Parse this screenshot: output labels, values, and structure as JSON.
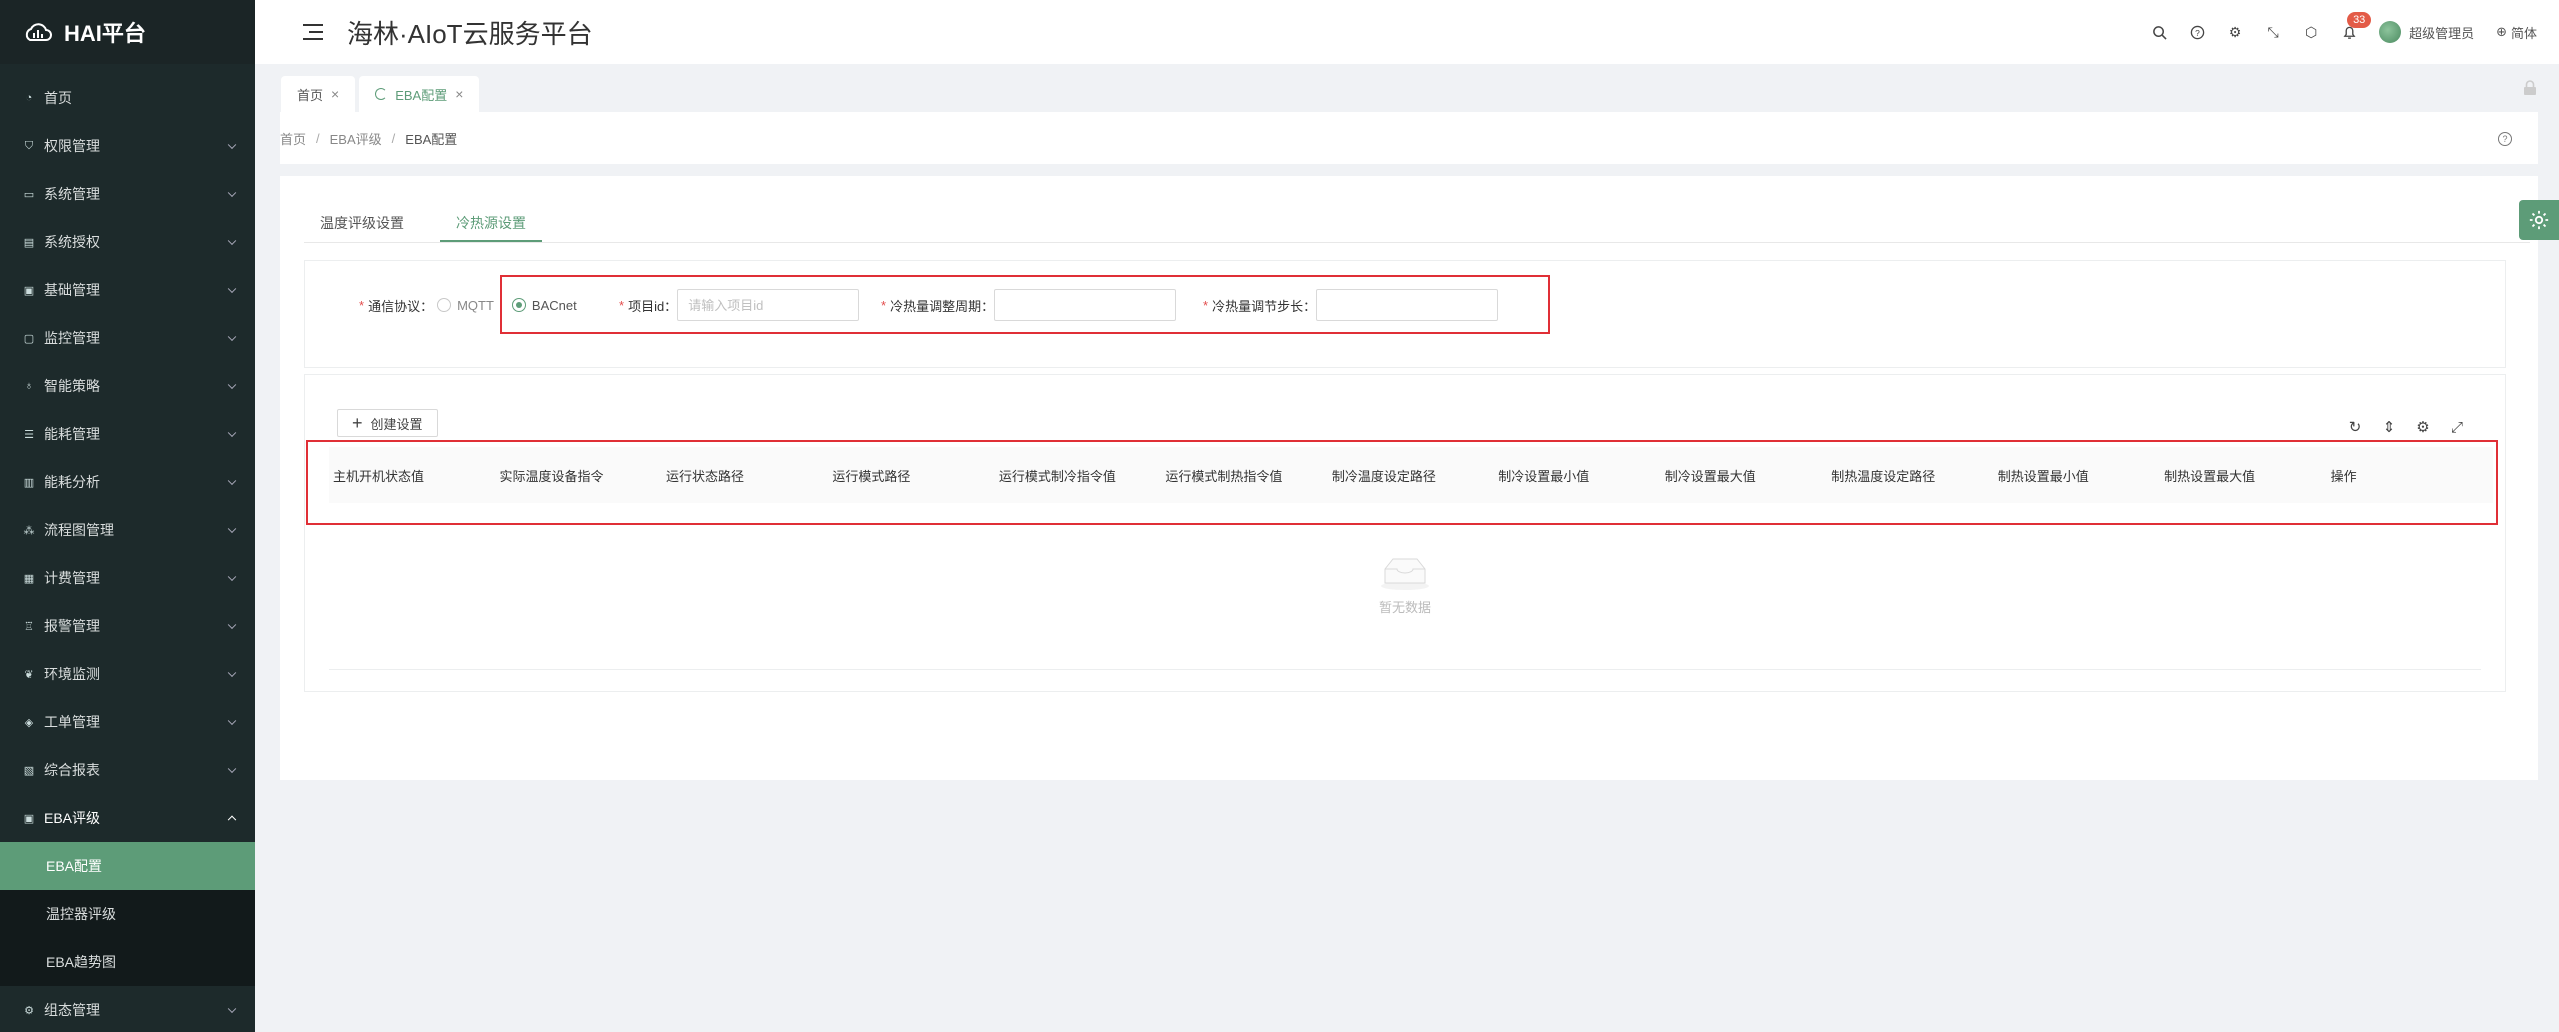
{
  "sidebar": {
    "logo": "HAI平台",
    "items": [
      {
        "label": "首页",
        "icon": "dashboard-icon"
      },
      {
        "label": "权限管理",
        "icon": "shield-icon"
      },
      {
        "label": "系统管理",
        "icon": "monitor-icon"
      },
      {
        "label": "系统授权",
        "icon": "doc-icon"
      },
      {
        "label": "基础管理",
        "icon": "box-icon"
      },
      {
        "label": "监控管理",
        "icon": "screen-icon"
      },
      {
        "label": "智能策略",
        "icon": "bulb-icon"
      },
      {
        "label": "能耗管理",
        "icon": "list-icon"
      },
      {
        "label": "能耗分析",
        "icon": "bar-icon"
      },
      {
        "label": "流程图管理",
        "icon": "flow-icon"
      },
      {
        "label": "计费管理",
        "icon": "bill-icon"
      },
      {
        "label": "报警管理",
        "icon": "alarm-icon"
      },
      {
        "label": "环境监测",
        "icon": "leaf-icon"
      },
      {
        "label": "工单管理",
        "icon": "layers-icon"
      },
      {
        "label": "综合报表",
        "icon": "report-icon"
      }
    ],
    "open_group": {
      "label": "EBA评级",
      "icon": "calendar-icon"
    },
    "sub_items": [
      {
        "label": "EBA配置",
        "active": true
      },
      {
        "label": "温控器评级",
        "active": false
      },
      {
        "label": "EBA趋势图",
        "active": false
      }
    ],
    "last_item": {
      "label": "组态管理",
      "icon": "gear-icon"
    }
  },
  "header": {
    "title": "海林·AIoT云服务平台",
    "notification_count": "33",
    "username": "超级管理员",
    "language": "简体"
  },
  "tabs": [
    {
      "label": "首页",
      "active": false
    },
    {
      "label": "EBA配置",
      "active": true
    }
  ],
  "breadcrumb": [
    "首页",
    "EBA评级",
    "EBA配置"
  ],
  "content_tabs": [
    {
      "label": "温度评级设置",
      "active": false
    },
    {
      "label": "冷热源设置",
      "active": true
    }
  ],
  "form": {
    "protocol_label": "通信协议：",
    "protocol_options": [
      "MQTT",
      "BACnet"
    ],
    "protocol_selected": "BACnet",
    "project_id_label": "项目id：",
    "project_id_placeholder": "请输入项目id",
    "period_label": "冷热量调整周期：",
    "step_label": "冷热量调节步长："
  },
  "table": {
    "create_button": "创建设置",
    "columns": [
      "主机开机状态值",
      "实际温度设备指令",
      "运行状态路径",
      "运行模式路径",
      "运行模式制冷指令值",
      "运行模式制热指令值",
      "制冷温度设定路径",
      "制冷设置最小值",
      "制冷设置最大值",
      "制热温度设定路径",
      "制热设置最小值",
      "制热设置最大值",
      "操作"
    ],
    "empty_text": "暂无数据"
  },
  "colors": {
    "accent": "#5d9c78",
    "sidebar": "#1d2a2b",
    "highlight": "#e02f36"
  }
}
